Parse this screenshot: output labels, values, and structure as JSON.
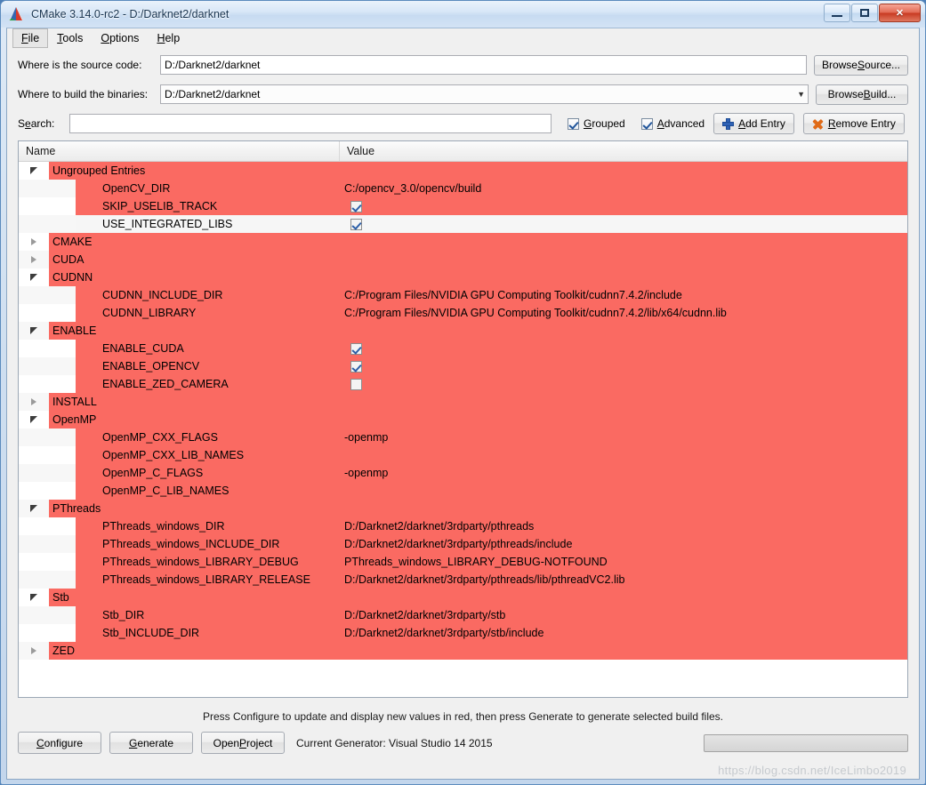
{
  "window": {
    "title": "CMake 3.14.0-rc2 - D:/Darknet2/darknet",
    "app_icon": "cmake-logo-icon",
    "minimize_label": "–",
    "maximize_label": "□",
    "close_label": "✕"
  },
  "menu": {
    "items": [
      {
        "label": "File",
        "mnemonic": "F",
        "active": true
      },
      {
        "label": "Tools",
        "mnemonic": "T",
        "active": false
      },
      {
        "label": "Options",
        "mnemonic": "O",
        "active": false
      },
      {
        "label": "Help",
        "mnemonic": "H",
        "active": false
      }
    ]
  },
  "form": {
    "source_label": "Where is the source code:",
    "source_value": "D:/Darknet2/darknet",
    "browse_source_label": "Browse Source...",
    "browse_source_mnemonic": "S",
    "build_label": "Where to build the binaries:",
    "build_value": "D:/Darknet2/darknet",
    "browse_build_label": "Browse Build...",
    "browse_build_mnemonic": "B",
    "search_label": "Search:",
    "search_mnemonic": "e",
    "search_value": "",
    "search_placeholder": "",
    "grouped_label": "Grouped",
    "grouped_mnemonic": "G",
    "grouped_checked": true,
    "advanced_label": "Advanced",
    "advanced_mnemonic": "A",
    "advanced_checked": true,
    "add_entry_label": "Add Entry",
    "add_entry_mnemonic": "A",
    "remove_entry_label": "Remove Entry",
    "remove_entry_mnemonic": "R"
  },
  "table": {
    "col_name": "Name",
    "col_value": "Value",
    "rows": [
      {
        "kind": "group",
        "name": "Ungrouped Entries",
        "expanded": true,
        "value": "",
        "red": true,
        "alt": false
      },
      {
        "kind": "child",
        "name": "OpenCV_DIR",
        "value": "C:/opencv_3.0/opencv/build",
        "red": true,
        "alt": true
      },
      {
        "kind": "child",
        "name": "SKIP_USELIB_TRACK",
        "value": "",
        "checkbox": true,
        "checked": true,
        "red": true,
        "alt": false
      },
      {
        "kind": "child",
        "name": "USE_INTEGRATED_LIBS",
        "value": "",
        "checkbox": true,
        "checked": true,
        "red": false,
        "alt": true
      },
      {
        "kind": "group",
        "name": "CMAKE",
        "expanded": false,
        "value": "",
        "red": true,
        "alt": false
      },
      {
        "kind": "group",
        "name": "CUDA",
        "expanded": false,
        "value": "",
        "red": true,
        "alt": true
      },
      {
        "kind": "group",
        "name": "CUDNN",
        "expanded": true,
        "value": "",
        "red": true,
        "alt": false
      },
      {
        "kind": "child",
        "name": "CUDNN_INCLUDE_DIR",
        "value": "C:/Program Files/NVIDIA GPU Computing Toolkit/cudnn7.4.2/include",
        "red": true,
        "alt": true
      },
      {
        "kind": "child",
        "name": "CUDNN_LIBRARY",
        "value": "C:/Program Files/NVIDIA GPU Computing Toolkit/cudnn7.4.2/lib/x64/cudnn.lib",
        "red": true,
        "alt": false
      },
      {
        "kind": "group",
        "name": "ENABLE",
        "expanded": true,
        "value": "",
        "red": true,
        "alt": true
      },
      {
        "kind": "child",
        "name": "ENABLE_CUDA",
        "value": "",
        "checkbox": true,
        "checked": true,
        "red": true,
        "alt": false
      },
      {
        "kind": "child",
        "name": "ENABLE_OPENCV",
        "value": "",
        "checkbox": true,
        "checked": true,
        "red": true,
        "alt": true
      },
      {
        "kind": "child",
        "name": "ENABLE_ZED_CAMERA",
        "value": "",
        "checkbox": true,
        "checked": false,
        "red": true,
        "alt": false
      },
      {
        "kind": "group",
        "name": "INSTALL",
        "expanded": false,
        "value": "",
        "red": true,
        "alt": true
      },
      {
        "kind": "group",
        "name": "OpenMP",
        "expanded": true,
        "value": "",
        "red": true,
        "alt": false
      },
      {
        "kind": "child",
        "name": "OpenMP_CXX_FLAGS",
        "value": "-openmp",
        "red": true,
        "alt": true
      },
      {
        "kind": "child",
        "name": "OpenMP_CXX_LIB_NAMES",
        "value": "",
        "red": true,
        "alt": false
      },
      {
        "kind": "child",
        "name": "OpenMP_C_FLAGS",
        "value": "-openmp",
        "red": true,
        "alt": true
      },
      {
        "kind": "child",
        "name": "OpenMP_C_LIB_NAMES",
        "value": "",
        "red": true,
        "alt": false
      },
      {
        "kind": "group",
        "name": "PThreads",
        "expanded": true,
        "value": "",
        "red": true,
        "alt": true
      },
      {
        "kind": "child",
        "name": "PThreads_windows_DIR",
        "value": "D:/Darknet2/darknet/3rdparty/pthreads",
        "red": true,
        "alt": false
      },
      {
        "kind": "child",
        "name": "PThreads_windows_INCLUDE_DIR",
        "value": "D:/Darknet2/darknet/3rdparty/pthreads/include",
        "red": true,
        "alt": true
      },
      {
        "kind": "child",
        "name": "PThreads_windows_LIBRARY_DEBUG",
        "value": "PThreads_windows_LIBRARY_DEBUG-NOTFOUND",
        "red": true,
        "alt": false
      },
      {
        "kind": "child",
        "name": "PThreads_windows_LIBRARY_RELEASE",
        "value": "D:/Darknet2/darknet/3rdparty/pthreads/lib/pthreadVC2.lib",
        "red": true,
        "alt": true
      },
      {
        "kind": "group",
        "name": "Stb",
        "expanded": true,
        "value": "",
        "red": true,
        "alt": false
      },
      {
        "kind": "child",
        "name": "Stb_DIR",
        "value": "D:/Darknet2/darknet/3rdparty/stb",
        "red": true,
        "alt": true
      },
      {
        "kind": "child",
        "name": "Stb_INCLUDE_DIR",
        "value": "D:/Darknet2/darknet/3rdparty/stb/include",
        "red": true,
        "alt": false
      },
      {
        "kind": "group",
        "name": "ZED",
        "expanded": false,
        "value": "",
        "red": true,
        "alt": true
      }
    ]
  },
  "footer": {
    "hint": "Press Configure to update and display new values in red, then press Generate to generate selected build files.",
    "configure_label": "Configure",
    "configure_mnemonic": "C",
    "generate_label": "Generate",
    "generate_mnemonic": "G",
    "open_project_label": "Open Project",
    "open_project_mnemonic": "P",
    "generator_text": "Current Generator: Visual Studio 14 2015",
    "progress_value": 0
  },
  "watermark": "https://blog.csdn.net/IceLimbo2019",
  "colors": {
    "new_value_red": "#fa6a62",
    "accent_blue": "#2f62b5",
    "remove_orange": "#e06a16"
  }
}
